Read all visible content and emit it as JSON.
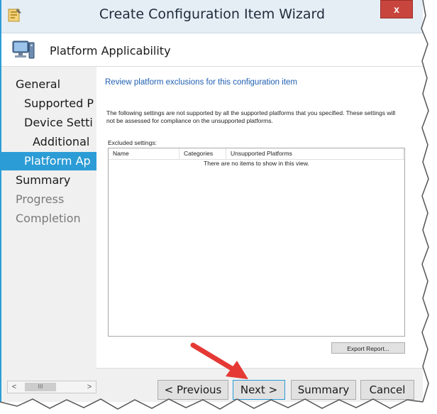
{
  "window": {
    "title": "Create Configuration Item Wizard",
    "close_label": "x",
    "accent_color": "#2c9cd6",
    "app_icon": "wizard-app-icon"
  },
  "header": {
    "title": "Platform Applicability",
    "icon": "computer-icon"
  },
  "nav": {
    "items": [
      {
        "label": "General"
      },
      {
        "label": "Supported P"
      },
      {
        "label": "Device Setti"
      },
      {
        "label": "Additional"
      },
      {
        "label": "Platform Ap"
      },
      {
        "label": "Summary"
      },
      {
        "label": "Progress"
      },
      {
        "label": "Completion"
      }
    ],
    "scroll_left": "<",
    "scroll_thumb": "III",
    "scroll_right": ">"
  },
  "content": {
    "heading": "Review platform exclusions for this configuration item",
    "description": "The following settings are not supported by all the supported platforms that you specified. These settings will not be assessed for compliance on the unsupported platforms.",
    "excluded_label": "Excluded settings:",
    "columns": [
      "Name",
      "Categories",
      "Unsupported Platforms"
    ],
    "empty_text": "There are no items to show in this view.",
    "export_label": "Export Report..."
  },
  "footer": {
    "previous_label": "< Previous",
    "next_label": "Next >",
    "summary_label": "Summary",
    "cancel_label": "Cancel"
  },
  "annotation": {
    "arrow_color": "#e53935"
  }
}
